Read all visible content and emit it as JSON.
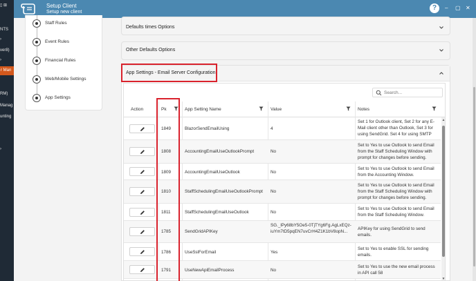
{
  "background_app": {
    "texts": [
      "NTS",
      "ver8)",
      "r Man",
      "RM)",
      "Manag",
      "unting"
    ],
    "highlight_color": "#d3581c"
  },
  "titlebar": {
    "title": "Setup Client",
    "subtitle": "Setup new client",
    "help_label": "?",
    "minimize": "–",
    "maximize": "▢",
    "close": "✕",
    "color": "#4b88b1"
  },
  "steps": [
    {
      "label": "Staff Rules"
    },
    {
      "label": "Event Rules"
    },
    {
      "label": "Financial Rules"
    },
    {
      "label": "Web/Mobile Settings"
    },
    {
      "label": "App Settings"
    }
  ],
  "sections": {
    "defaults_times": "Defaults times Options",
    "other_defaults": "Other Defaults Options",
    "app_settings": "App Settings - Email Server Configuration"
  },
  "grid": {
    "search_placeholder": "Search...",
    "headers": {
      "action": "Action",
      "pk": "Pk",
      "name": "App Setting Name",
      "value": "Value",
      "notes": "Notes"
    },
    "rows": [
      {
        "pk": "1849",
        "name": "BlazorSendEmailUsing",
        "value": "4",
        "notes": "Set 1 for Outlook client, Set 2 for any E-Mail client other than Outlook, Set 3 for using SendGrid. Set 4 for using SMTP"
      },
      {
        "pk": "1808",
        "name": "AccountingEmailUseOutlookPrompt",
        "value": "No",
        "notes": "Set to Yes to use Outlook to send Email from the Staff Scheduling Window with prompt for changes before sending."
      },
      {
        "pk": "1809",
        "name": "AccountingEmailUseOutlook",
        "value": "No",
        "notes": "Set to Yes to use Outlook to send Email from the Accounting Window."
      },
      {
        "pk": "1810",
        "name": "StaffSchedulingEmailUseOutlookPrompt",
        "value": "No",
        "notes": "Set to Yes to use Outlook to send Email from the Staff Scheduling Window with prompt for changes before sending."
      },
      {
        "pk": "1811",
        "name": "StaffSchedulingEmailUseOutlook",
        "value": "No",
        "notes": "Set to Yes to use Outlook to send Email from the Staff Scheduling Window."
      },
      {
        "pk": "1785",
        "name": "SendGridAPIKey",
        "value": "SG._lPy68bY5Oe5-0TjTYg6Fg.AgLxEQz-iuYm7tD5pqEN7uvCrH4Z1K1bV8opN...",
        "notes": "APIKey for using SendGrid to send emails."
      },
      {
        "pk": "1786",
        "name": "UseSslForEmail",
        "value": "Yes",
        "notes": "Set to Yes to enable SSL for sending emails."
      },
      {
        "pk": "1791",
        "name": "UseNewApiEmailProcess",
        "value": "No",
        "notes": "Set to Yes to use the new email process in API call 58"
      }
    ]
  },
  "highlight_color": "#d9212c"
}
